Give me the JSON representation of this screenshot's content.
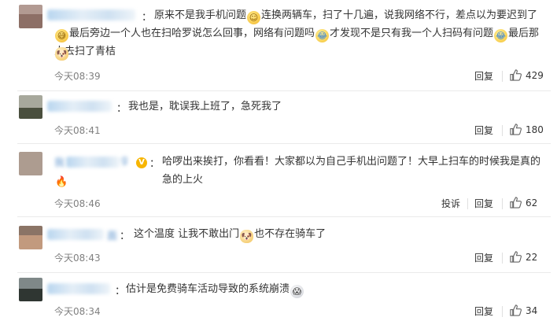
{
  "comments": [
    {
      "user": "用户名称",
      "text_1": "原来不是我手机问题",
      "emoji_1": "smile-emoji",
      "text_2": "连换两辆车，扫了十几遍，说我网络不行，差点以为要迟到了",
      "emoji_2": "sweat-emoji",
      "text_3": "最后旁边一个人也在扫哈罗说怎么回事，网络有问题吗",
      "emoji_3": "cry-laugh-emoji",
      "text_4": "才发现不是只有我一个人扫码有问题",
      "emoji_4": "cry-laugh-emoji",
      "text_5": "最后那人去扫了青桔",
      "emoji_5": "dog-emoji",
      "time": "今天08:39",
      "reply": "回复",
      "likes": "429"
    },
    {
      "user": "用户名称",
      "text": "我也是，耽误我上班了，急死我了",
      "time": "今天08:41",
      "reply": "回复",
      "likes": "180"
    },
    {
      "user": "我",
      "user_suffix": "g",
      "verified": "V",
      "text_1": "哈啰出来挨打，你看看！大家都以为自己手机出问题了！大早上扫车的时候我是真的急的上火",
      "emoji_1": "fire-emoji",
      "time": "今天08:46",
      "report": "投诉",
      "reply": "回复",
      "likes": "62"
    },
    {
      "user": "面",
      "text_1": "这个温度 让我不敢出门",
      "emoji_1": "dog-emoji",
      "text_2": "也不存在骑车了",
      "time": "今天08:43",
      "reply": "回复",
      "likes": "22"
    },
    {
      "user": "用户名称",
      "text_1": "估计是免费骑车活动导致的系统崩溃",
      "emoji_1": "shock-emoji",
      "time": "今天08:34",
      "reply": "回复",
      "likes": "34"
    }
  ],
  "colors": {
    "link": "#4a87c7",
    "text": "#333333",
    "time": "#808080",
    "divider": "#eaeaea",
    "verified": "#f7b500"
  }
}
